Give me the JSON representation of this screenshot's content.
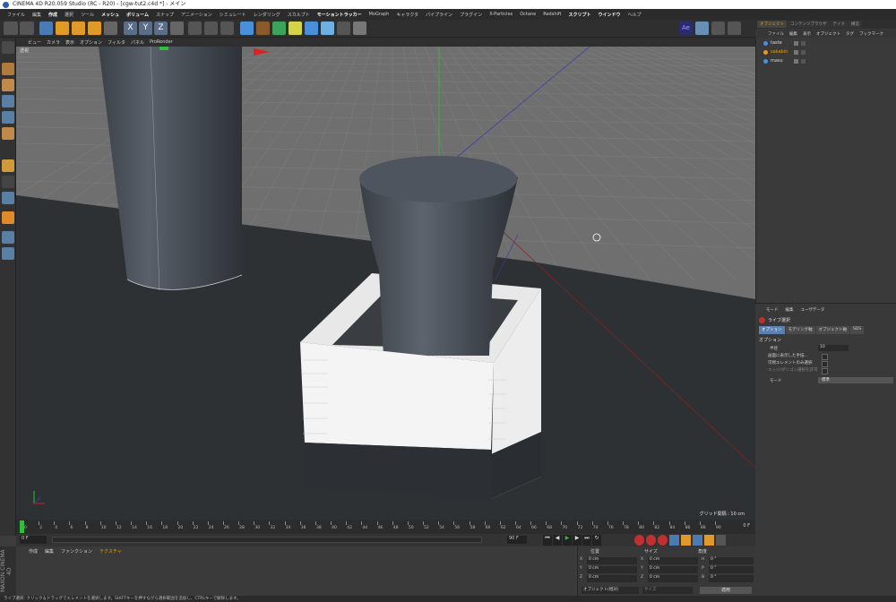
{
  "window": {
    "title": "CINEMA 4D R20.059 Studio (RC - R20) - [cgw-tut2.c4d *] - メイン"
  },
  "menubar": [
    "ファイル",
    "編集",
    "作成",
    "選択",
    "ツール",
    "メッシュ",
    "ボリューム",
    "スナップ",
    "アニメーション",
    "シミュレート",
    "レンダリング",
    "スカルプト",
    "モーショントラッカー",
    "MoGraph",
    "キャラクタ",
    "パイプライン",
    "プラグイン",
    "X-Particles",
    "Octane",
    "Redshift",
    "スクリプト",
    "ウインドウ",
    "ヘルプ"
  ],
  "viewport": {
    "menu": [
      "ビュー",
      "カメラ",
      "表示",
      "オプション",
      "フィルタ",
      "パネル",
      "ProRender"
    ],
    "label": "透視",
    "grid_label": "グリッド間隔 : 10 cm",
    "colors": {
      "floor": "#2e3134",
      "grid_plane": "#6f6f6f",
      "object": "#4a4f56",
      "box": "#f2f2f2"
    }
  },
  "timeline": {
    "ticks": [
      "0",
      "2",
      "4",
      "6",
      "8",
      "10",
      "12",
      "14",
      "16",
      "18",
      "20",
      "22",
      "24",
      "26",
      "28",
      "30",
      "32",
      "34",
      "36",
      "38",
      "40",
      "42",
      "44",
      "46",
      "48",
      "50",
      "52",
      "54",
      "56",
      "58",
      "60",
      "62",
      "64",
      "66",
      "68",
      "70",
      "72",
      "74",
      "76",
      "78",
      "80",
      "82",
      "84",
      "86",
      "88",
      "90"
    ],
    "end_label": "0 F",
    "current_frame": "0 F",
    "start_field": "0 F",
    "end_field": "90 F",
    "end_field2": "90 F"
  },
  "materials": {
    "menu": [
      "作成",
      "編集",
      "ファンクション",
      "テクスチャ"
    ]
  },
  "coords": {
    "headers": [
      "位置",
      "サイズ",
      "角度"
    ],
    "rows": [
      {
        "axis": "X",
        "pos": "0 cm",
        "size": "0 cm",
        "ang_axis": "H",
        "ang": "0 °"
      },
      {
        "axis": "Y",
        "pos": "0 cm",
        "size": "0 cm",
        "ang_axis": "P",
        "ang": "0 °"
      },
      {
        "axis": "Z",
        "pos": "0 cm",
        "size": "0 cm",
        "ang_axis": "B",
        "ang": "0 °"
      }
    ],
    "mode": "オブジェクト(相対)",
    "size_mode": "サイズ",
    "apply": "適用"
  },
  "manager": {
    "tabs": [
      "オブジェクト",
      "コンテンツブラウザ",
      "テイク",
      "構造"
    ],
    "menu": [
      "ファイル",
      "編集",
      "表示",
      "オブジェクト",
      "タグ",
      "ブックマーク"
    ],
    "objects": [
      "taste",
      "sakabin",
      "masu"
    ]
  },
  "attributes": {
    "menu": [
      "モード",
      "編集",
      "ユーザデータ"
    ],
    "tool": "ライブ選択",
    "tabs": [
      "オプション",
      "モデリング軸",
      "オブジェクト軸",
      "SDS"
    ],
    "section": "オプション",
    "radius_label": "半径",
    "radius_value": "10",
    "rows": [
      "画面に表示した手描...",
      "可視エレメントのみ選択",
      "エッジ/ポリゴン選択を許可"
    ],
    "mode_label": "モード",
    "mode_value": "標準"
  },
  "status": "ライブ選択: クリック＆ドラッグでエレメントを選択します。SHIFTキーを押すながら選択範囲を追加し、CTRLキーで解除します。"
}
